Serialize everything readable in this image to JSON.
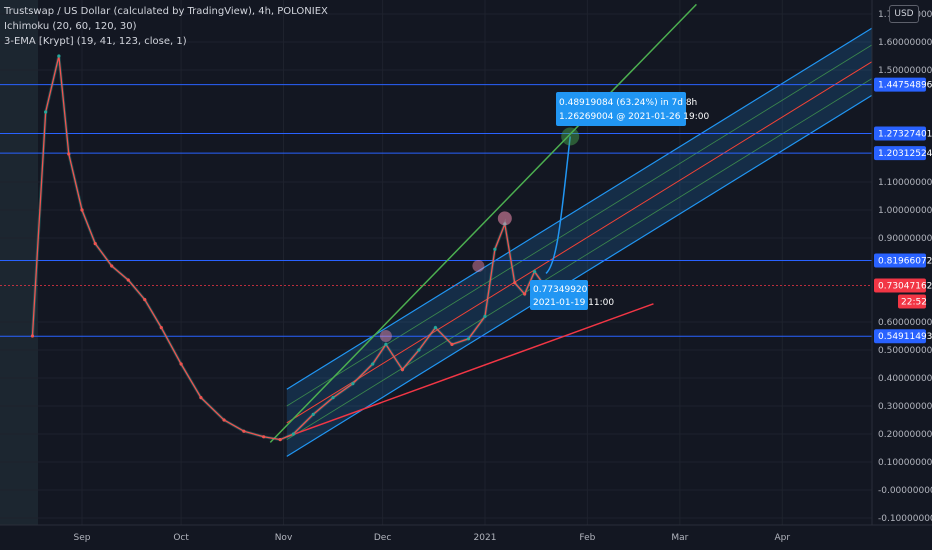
{
  "legend": {
    "symbol": "Trustswap / US Dollar (calculated by TradingView), 4h, POLONIEX",
    "ichimoku": "Ichimoku (20, 60, 120, 30)",
    "ema": "3-EMA [Krypt] (19, 41, 123, close, 1)"
  },
  "currency_button": "USD",
  "colors": {
    "background": "#131722",
    "up_candle": "#26a69a",
    "down_candle": "#ef5350",
    "hline": "#2962ff",
    "trend_green": "#4caf50",
    "trend_red": "#f23645",
    "channel": "#2196f3",
    "current_price": "#f23645"
  },
  "chart_data": {
    "type": "line",
    "title": "Trustswap / US Dollar (calculated by TradingView), 4h, POLONIEX",
    "xlabel": "",
    "ylabel": "",
    "ylim": [
      -0.1,
      1.75
    ],
    "grid": true,
    "x_ticks": [
      "Sep",
      "Oct",
      "Nov",
      "Dec",
      "2021",
      "Feb",
      "Mar",
      "Apr"
    ],
    "y_ticks": [
      "1.70000000",
      "1.60000000",
      "1.50000000",
      "1.10000000",
      "1.00000000",
      "0.90000000",
      "0.60000000",
      "0.50000000",
      "0.40000000",
      "0.30000000",
      "0.20000000",
      "0.10000000",
      "-0.00000000",
      "-0.10000000"
    ],
    "y_tick_values": [
      1.7,
      1.6,
      1.5,
      1.1,
      1.0,
      0.9,
      0.6,
      0.5,
      0.4,
      0.3,
      0.2,
      0.1,
      0.0,
      -0.1
    ],
    "price_series": {
      "x": [
        "2020-08-17",
        "2020-08-21",
        "2020-08-25",
        "2020-08-28",
        "2020-09-01",
        "2020-09-05",
        "2020-09-10",
        "2020-09-15",
        "2020-09-20",
        "2020-09-25",
        "2020-10-01",
        "2020-10-07",
        "2020-10-14",
        "2020-10-20",
        "2020-10-26",
        "2020-10-31",
        "2020-11-04",
        "2020-11-10",
        "2020-11-16",
        "2020-11-22",
        "2020-11-28",
        "2020-12-02",
        "2020-12-07",
        "2020-12-12",
        "2020-12-17",
        "2020-12-22",
        "2020-12-27",
        "2021-01-01",
        "2021-01-04",
        "2021-01-07",
        "2021-01-10",
        "2021-01-13",
        "2021-01-16",
        "2021-01-19"
      ],
      "y": [
        0.55,
        1.35,
        1.55,
        1.2,
        1.0,
        0.88,
        0.8,
        0.75,
        0.68,
        0.58,
        0.45,
        0.33,
        0.25,
        0.21,
        0.19,
        0.18,
        0.2,
        0.27,
        0.33,
        0.38,
        0.45,
        0.52,
        0.43,
        0.5,
        0.58,
        0.52,
        0.54,
        0.62,
        0.86,
        0.95,
        0.74,
        0.7,
        0.78,
        0.73
      ]
    },
    "horizontal_levels": [
      1.44754896,
      1.27327401,
      1.20312524,
      0.81966072,
      0.54911493
    ],
    "current_price": 0.73047162,
    "countdown": "22:52",
    "projection": {
      "label": "0.48919084 (63.24%) in 7d 8h",
      "sublabel": "1.26269004 @ 2021-01-26  19:00",
      "from_value": 0.7734992,
      "from_label": "0.77349920",
      "from_time": "2021-01-19 11:00"
    }
  }
}
